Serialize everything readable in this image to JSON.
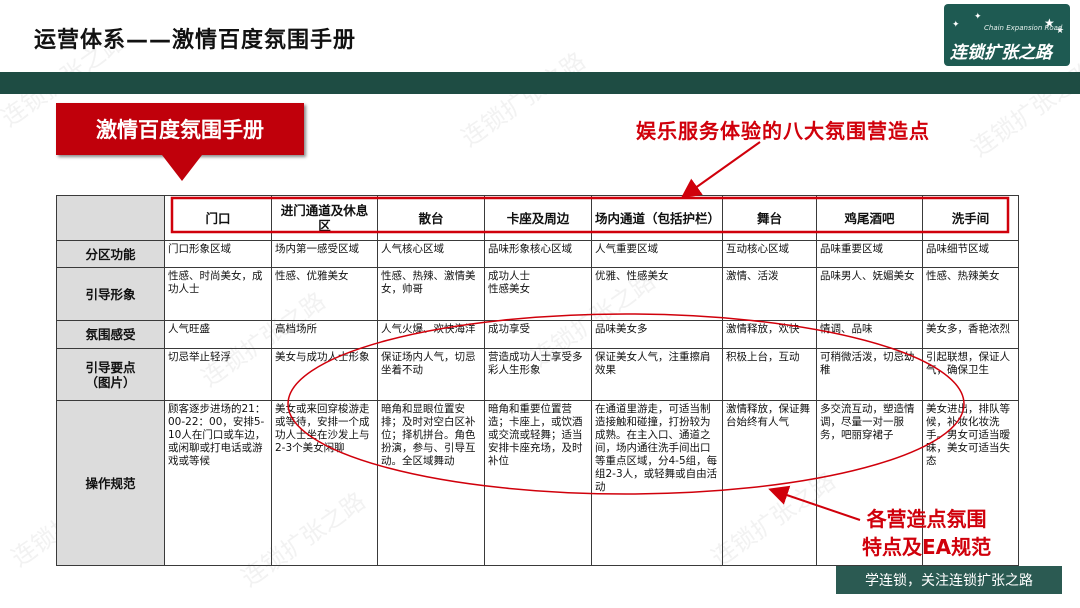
{
  "page": {
    "title": "运营体系——激情百度氛围手册",
    "tag": "激情百度氛围手册",
    "callout_top": "娱乐服务体验的八大氛围营造点",
    "callout_bottom_line1": "各营造点氛围",
    "callout_bottom_line2": "特点及EA规范",
    "footer": "学连锁，关注连锁扩张之路"
  },
  "logo": {
    "subtitle": "Chain Expansion Road",
    "name": "连锁扩张之路"
  },
  "watermark": "连锁扩张之路",
  "table": {
    "columns": [
      "门口",
      "进门通道及休息区",
      "散台",
      "卡座及周边",
      "场内通道（包括护栏）",
      "舞台",
      "鸡尾酒吧",
      "洗手间"
    ],
    "rows": [
      {
        "label": "分区功能",
        "cells": [
          "门口形象区域",
          "场内第一感受区域",
          "人气核心区域",
          "品味形象核心区域",
          "人气重要区域",
          "互动核心区域",
          "品味重要区域",
          "品味细节区域"
        ]
      },
      {
        "label": "引导形象",
        "cells": [
          "性感、时尚美女，成功人士",
          "性感、优雅美女",
          "性感、热辣、激情美女，帅哥",
          "成功人士\n性感美女",
          "优雅、性感美女",
          "激情、活泼",
          "品味男人、妩媚美女",
          "性感、热辣美女"
        ]
      },
      {
        "label": "氛围感受",
        "cells": [
          "人气旺盛",
          "高档场所",
          "人气火爆、欢快海洋",
          "成功享受",
          "品味美女多",
          "激情释放，欢快",
          "情调、品味",
          "美女多，香艳浓烈"
        ]
      },
      {
        "label": "引导要点\n（图片）",
        "cells": [
          "切忌举止轻浮",
          "美女与成功人士形象",
          "保证场内人气，切忌坐着不动",
          "营造成功人士享受多彩人生形象",
          "保证美女人气，注重擦肩效果",
          "积极上台，互动",
          "可稍微活泼，切忌幼稚",
          "引起联想，保证人气，确保卫生"
        ]
      },
      {
        "label": "操作规范",
        "cells": [
          "顾客逐步进场的21：00-22：00，安排5-10人在门口或车边，或闲聊或打电话或游戏或等候",
          "美女或来回穿梭游走或等待，安排一个成功人士坐在沙发上与2-3个美女闲聊",
          "暗角和显眼位置安排；及时对空白区补位；择机拼台。角色扮演，参与、引导互动。全区域舞动",
          "暗角和重要位置营造；卡座上，或饮酒或交流或轻舞；适当安排卡座充场，及时补位",
          "在通道里游走，可适当制造接触和碰撞，打扮较为成熟。在主入口、通道之间，场内通往洗手间出口等重点区域，分4-5组，每组2-3人，或轻舞或自由活动",
          "激情释放，保证舞台始终有人气",
          "多交流互动，塑造情调，尽量一对一服务，吧丽穿裙子",
          "美女进出，排队等候，补妆化妆洗手。男女可适当暧昧，美女可适当失态"
        ]
      }
    ]
  },
  "colors": {
    "accent_red": "#c0000b",
    "callout_red": "#d0000b",
    "band_green": "#1e4c43",
    "footer_green": "#2b5a52",
    "header_gray": "#dcdcdc"
  }
}
